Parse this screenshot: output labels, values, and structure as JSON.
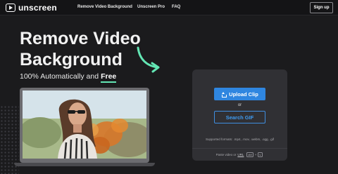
{
  "header": {
    "logo_text": "unscreen",
    "nav": [
      {
        "label": "Remove Video Background"
      },
      {
        "label": "Unscreen Pro"
      },
      {
        "label": "FAQ"
      }
    ],
    "signup_label": "Sign up"
  },
  "hero": {
    "title_line1": "Remove Video",
    "title_line2": "Background",
    "subtitle_prefix": "100% Automatically and",
    "subtitle_emph": "Free"
  },
  "upload_card": {
    "upload_label": "Upload Clip",
    "or_text": "or",
    "search_label": "Search GIF",
    "formats_text": "Supported formats: .mp4, .mov, .webm, .ogg, .gif",
    "paste_prefix": "Paste video or",
    "paste_url": "URL",
    "kbd_ctrl": "ctrl",
    "kbd_plus": "+",
    "kbd_v": "v"
  },
  "colors": {
    "accent": "#2f86e0",
    "highlight": "#63e6b4",
    "background": "#1b1b1d",
    "card": "#303034"
  },
  "icons": [
    "unscreen-logo-icon",
    "curved-arrow-icon",
    "upload-icon"
  ]
}
